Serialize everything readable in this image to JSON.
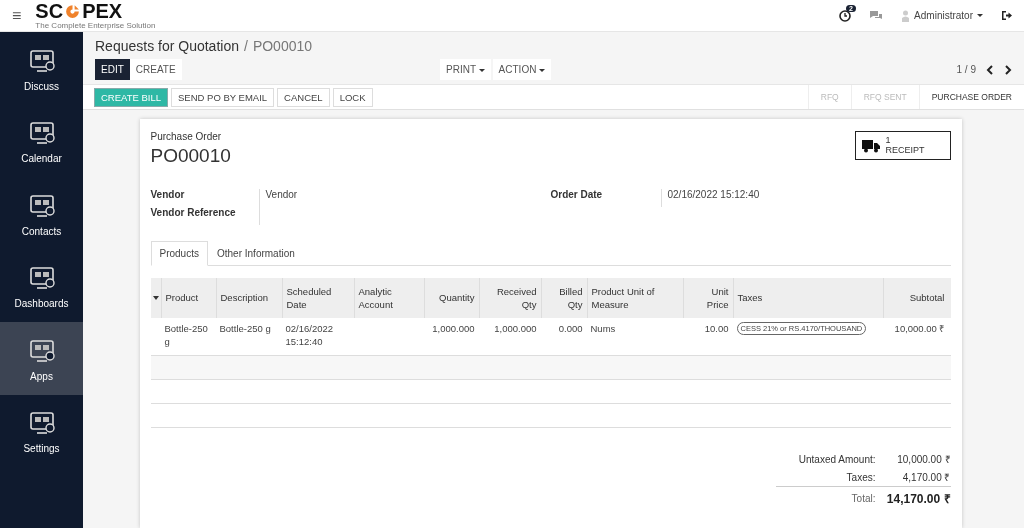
{
  "topbar": {
    "menu_icon": "≡",
    "logo": {
      "before": "SC",
      "after": "PEX",
      "tagline": "The Complete Enterprise Solution"
    },
    "activity_count": "2",
    "user": "Administrator"
  },
  "sidebar": {
    "items": [
      {
        "label": "Discuss",
        "selected": false
      },
      {
        "label": "Calendar",
        "selected": false
      },
      {
        "label": "Contacts",
        "selected": false
      },
      {
        "label": "Dashboards",
        "selected": false
      },
      {
        "label": "Apps",
        "selected": true
      },
      {
        "label": "Settings",
        "selected": false
      }
    ]
  },
  "breadcrumb": {
    "parent": "Requests for Quotation",
    "separator": "/",
    "current": "PO00010"
  },
  "buttons": [
    {
      "label": "EDIT",
      "kind": "primary"
    },
    {
      "label": "CREATE",
      "kind": "plain"
    }
  ],
  "menus": [
    "PRINT",
    "ACTION"
  ],
  "pager": "1 / 9",
  "actions": [
    {
      "label": "CREATE BILL",
      "kind": "highlight"
    },
    {
      "label": "SEND PO BY EMAIL",
      "kind": "plain"
    },
    {
      "label": "CANCEL",
      "kind": "plain"
    },
    {
      "label": "LOCK",
      "kind": "plain"
    }
  ],
  "status_steps": [
    {
      "label": "RFQ",
      "selected": false
    },
    {
      "label": "RFQ SENT",
      "selected": false
    },
    {
      "label": "PURCHASE ORDER",
      "selected": true
    }
  ],
  "form": {
    "caption": "Purchase Order",
    "name": "PO00010",
    "receipt": {
      "count": "1",
      "label": "RECEIPT"
    },
    "left_fields": [
      {
        "label": "Vendor",
        "value": "Vendor"
      },
      {
        "label": "Vendor Reference"
      }
    ],
    "right_fields": [
      {
        "label": "Order Date",
        "value": "02/16/2022 15:12:40"
      }
    ]
  },
  "tabs": [
    {
      "label": "Products",
      "selected": true
    },
    {
      "label": "Other Information",
      "selected": false
    }
  ],
  "table": {
    "columns": [
      {
        "label": "Product"
      },
      {
        "label": "Description"
      },
      {
        "label": "Scheduled Date"
      },
      {
        "label": "Analytic Account"
      },
      {
        "label": "Quantity"
      },
      {
        "label": "Received Qty"
      },
      {
        "label": "Billed Qty"
      },
      {
        "label": "Product Unit of Measure"
      },
      {
        "label": "Unit Price"
      },
      {
        "label": "Taxes"
      },
      {
        "label": "Subtotal"
      }
    ],
    "rows": [
      {
        "cells": [
          "Bottle-250 g",
          "Bottle-250 g",
          "02/16/2022 15:12:40",
          "",
          "1,000.000",
          "1,000.000",
          "0.000",
          "Nums",
          "10.00",
          "",
          "10,000.00 ₹"
        ],
        "tax_tag": "CESS 21% or RS.4170/THOUSAND"
      }
    ]
  },
  "totals": [
    {
      "label": "Untaxed Amount:",
      "value": "10,000.00 ₹",
      "kind": "line"
    },
    {
      "label": "Taxes:",
      "value": "4,170.00 ₹",
      "kind": "line"
    },
    {
      "label": "Total:",
      "value": "14,170.00 ₹",
      "kind": "total"
    }
  ]
}
